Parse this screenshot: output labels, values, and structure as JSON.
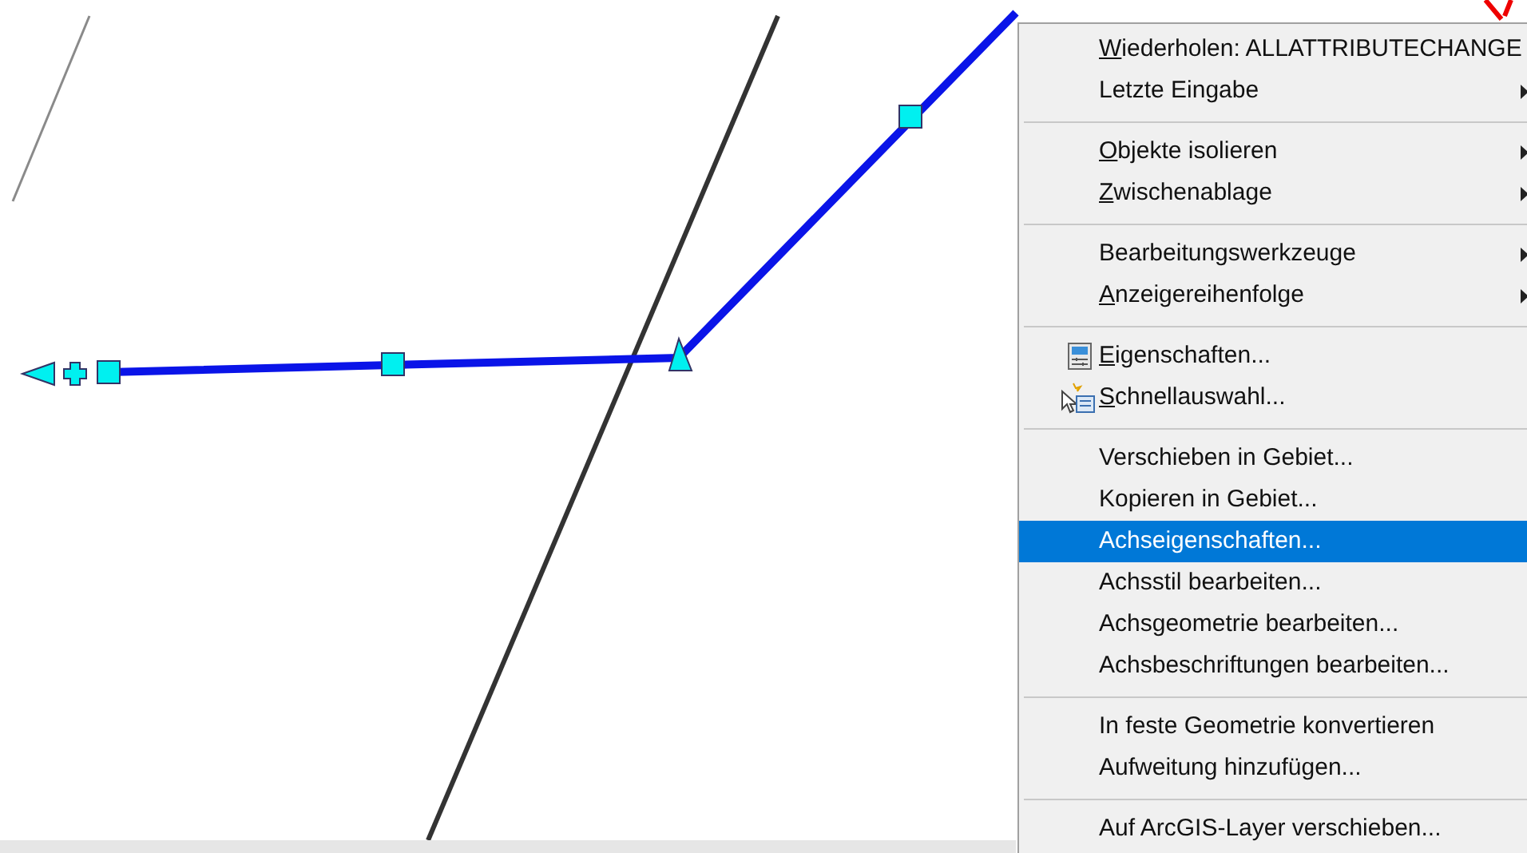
{
  "context_menu": {
    "groups": [
      {
        "items": [
          {
            "label": "Wiederholen: ALLATTRIBUTECHANGE",
            "kind": "plain",
            "underline_first": true,
            "submenu": false,
            "selected": false
          },
          {
            "label": "Letzte Eingabe",
            "kind": "plain",
            "underline_first": false,
            "submenu": true,
            "selected": false
          }
        ]
      },
      {
        "items": [
          {
            "label": "Objekte isolieren",
            "kind": "plain",
            "underline_first": true,
            "submenu": true,
            "selected": false
          },
          {
            "label": "Zwischenablage",
            "kind": "plain",
            "underline_first": true,
            "submenu": true,
            "selected": false
          }
        ]
      },
      {
        "items": [
          {
            "label": "Bearbeitungswerkzeuge",
            "kind": "plain",
            "underline_first": false,
            "submenu": true,
            "selected": false
          },
          {
            "label": "Anzeigereihenfolge",
            "kind": "plain",
            "underline_first": true,
            "submenu": true,
            "selected": false
          }
        ]
      },
      {
        "items": [
          {
            "label": "Eigenschaften...",
            "kind": "properties",
            "underline_first": true,
            "submenu": false,
            "selected": false
          },
          {
            "label": "Schnellauswahl...",
            "kind": "quickselect",
            "underline_first": true,
            "submenu": false,
            "selected": false
          }
        ]
      },
      {
        "items": [
          {
            "label": "Verschieben in Gebiet...",
            "kind": "plain",
            "underline_first": false,
            "submenu": false,
            "selected": false
          },
          {
            "label": "Kopieren in Gebiet...",
            "kind": "plain",
            "underline_first": false,
            "submenu": false,
            "selected": false
          },
          {
            "label": "Achseigenschaften...",
            "kind": "plain",
            "underline_first": false,
            "submenu": false,
            "selected": true
          },
          {
            "label": "Achsstil bearbeiten...",
            "kind": "plain",
            "underline_first": false,
            "submenu": false,
            "selected": false
          },
          {
            "label": "Achsgeometrie bearbeiten...",
            "kind": "plain",
            "underline_first": false,
            "submenu": false,
            "selected": false
          },
          {
            "label": "Achsbeschriftungen bearbeiten...",
            "kind": "plain",
            "underline_first": false,
            "submenu": false,
            "selected": false
          }
        ]
      },
      {
        "items": [
          {
            "label": "In feste Geometrie konvertieren",
            "kind": "plain",
            "underline_first": false,
            "submenu": false,
            "selected": false
          },
          {
            "label": "Aufweitung hinzufügen...",
            "kind": "plain",
            "underline_first": false,
            "submenu": false,
            "selected": false
          }
        ]
      },
      {
        "items": [
          {
            "label": "Auf ArcGIS-Layer verschieben...",
            "kind": "plain",
            "underline_first": false,
            "submenu": false,
            "selected": false
          }
        ]
      }
    ]
  }
}
